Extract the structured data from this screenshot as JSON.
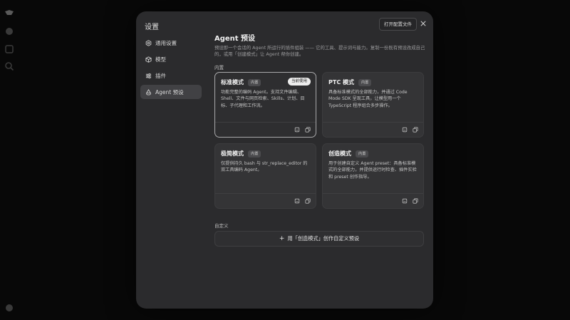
{
  "modal": {
    "title": "设置",
    "open_config_label": "打开配置文件"
  },
  "nav": {
    "items": [
      {
        "label": "通用设置",
        "icon": "gear-icon"
      },
      {
        "label": "模型",
        "icon": "cube-icon"
      },
      {
        "label": "插件",
        "icon": "sliders-icon"
      },
      {
        "label": "Agent 预设",
        "icon": "agent-icon",
        "active": true
      }
    ]
  },
  "main": {
    "title": "Agent 预设",
    "description": "预设即一个会话的 Agent 所运行的插件组装 —— 它的工具、提示词与能力。复制一份既有预设改成自己的，或用「创建模式」让 Agent 帮你创建。",
    "builtin_label": "内置",
    "custom_label": "自定义",
    "create_button_label": "用「创造模式」创作自定义预设"
  },
  "cards": [
    {
      "name": "标准模式",
      "tag": "内置",
      "current_badge": "当前使用",
      "desc": "功能完整的编码 Agent。支持文件编辑、Shell、文件与网页检索、Skills、计划、目标、子代理和工作流。"
    },
    {
      "name": "PTC 模式",
      "tag": "内置",
      "desc": "具备标准模式的全部能力，并通过 Code Mode SDK 呈现工具，让模型用一个 TypeScript 程序组合多步操作。"
    },
    {
      "name": "极简模式",
      "tag": "内置",
      "desc": "仅提供持久 bash 与 str_replace_editor 的双工具编码 Agent。"
    },
    {
      "name": "创造模式",
      "tag": "内置",
      "desc": "用于创建自定义 Agent preset：具备标准模式的全部能力，并提供运行时检查、插件实验和 preset 创作指导。"
    }
  ],
  "colors": {
    "modal_bg": "#2b2b2d",
    "card_bg": "#343436",
    "selected_border": "#a9a9ab",
    "badge_bg": "#ededed"
  }
}
